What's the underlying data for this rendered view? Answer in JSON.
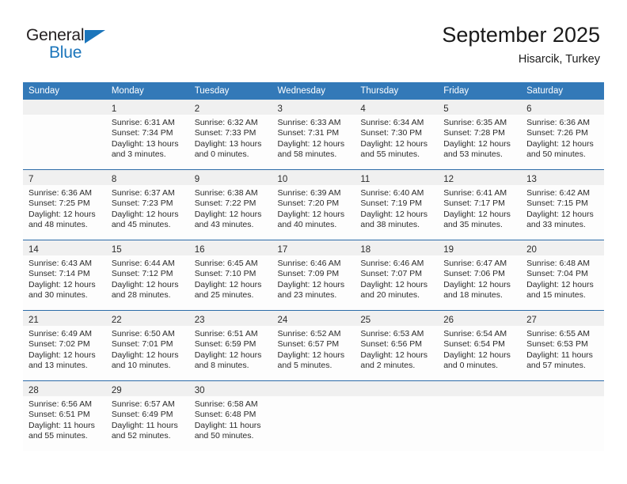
{
  "brand": {
    "name_part1": "General",
    "name_part2": "Blue",
    "triangle_color": "#1b75bb"
  },
  "header": {
    "title": "September 2025",
    "location": "Hisarcik, Turkey"
  },
  "theme": {
    "header_blue": "#3379b8",
    "rule_blue": "#2c6ba8",
    "daynum_band": "#f0f0f0"
  },
  "columns": [
    "Sunday",
    "Monday",
    "Tuesday",
    "Wednesday",
    "Thursday",
    "Friday",
    "Saturday"
  ],
  "weeks": [
    [
      {
        "day": "",
        "sunrise": "",
        "sunset": "",
        "daylight1": "",
        "daylight2": "",
        "empty": true
      },
      {
        "day": "1",
        "sunrise": "Sunrise: 6:31 AM",
        "sunset": "Sunset: 7:34 PM",
        "daylight1": "Daylight: 13 hours",
        "daylight2": "and 3 minutes.",
        "empty": false
      },
      {
        "day": "2",
        "sunrise": "Sunrise: 6:32 AM",
        "sunset": "Sunset: 7:33 PM",
        "daylight1": "Daylight: 13 hours",
        "daylight2": "and 0 minutes.",
        "empty": false
      },
      {
        "day": "3",
        "sunrise": "Sunrise: 6:33 AM",
        "sunset": "Sunset: 7:31 PM",
        "daylight1": "Daylight: 12 hours",
        "daylight2": "and 58 minutes.",
        "empty": false
      },
      {
        "day": "4",
        "sunrise": "Sunrise: 6:34 AM",
        "sunset": "Sunset: 7:30 PM",
        "daylight1": "Daylight: 12 hours",
        "daylight2": "and 55 minutes.",
        "empty": false
      },
      {
        "day": "5",
        "sunrise": "Sunrise: 6:35 AM",
        "sunset": "Sunset: 7:28 PM",
        "daylight1": "Daylight: 12 hours",
        "daylight2": "and 53 minutes.",
        "empty": false
      },
      {
        "day": "6",
        "sunrise": "Sunrise: 6:36 AM",
        "sunset": "Sunset: 7:26 PM",
        "daylight1": "Daylight: 12 hours",
        "daylight2": "and 50 minutes.",
        "empty": false
      }
    ],
    [
      {
        "day": "7",
        "sunrise": "Sunrise: 6:36 AM",
        "sunset": "Sunset: 7:25 PM",
        "daylight1": "Daylight: 12 hours",
        "daylight2": "and 48 minutes.",
        "empty": false
      },
      {
        "day": "8",
        "sunrise": "Sunrise: 6:37 AM",
        "sunset": "Sunset: 7:23 PM",
        "daylight1": "Daylight: 12 hours",
        "daylight2": "and 45 minutes.",
        "empty": false
      },
      {
        "day": "9",
        "sunrise": "Sunrise: 6:38 AM",
        "sunset": "Sunset: 7:22 PM",
        "daylight1": "Daylight: 12 hours",
        "daylight2": "and 43 minutes.",
        "empty": false
      },
      {
        "day": "10",
        "sunrise": "Sunrise: 6:39 AM",
        "sunset": "Sunset: 7:20 PM",
        "daylight1": "Daylight: 12 hours",
        "daylight2": "and 40 minutes.",
        "empty": false
      },
      {
        "day": "11",
        "sunrise": "Sunrise: 6:40 AM",
        "sunset": "Sunset: 7:19 PM",
        "daylight1": "Daylight: 12 hours",
        "daylight2": "and 38 minutes.",
        "empty": false
      },
      {
        "day": "12",
        "sunrise": "Sunrise: 6:41 AM",
        "sunset": "Sunset: 7:17 PM",
        "daylight1": "Daylight: 12 hours",
        "daylight2": "and 35 minutes.",
        "empty": false
      },
      {
        "day": "13",
        "sunrise": "Sunrise: 6:42 AM",
        "sunset": "Sunset: 7:15 PM",
        "daylight1": "Daylight: 12 hours",
        "daylight2": "and 33 minutes.",
        "empty": false
      }
    ],
    [
      {
        "day": "14",
        "sunrise": "Sunrise: 6:43 AM",
        "sunset": "Sunset: 7:14 PM",
        "daylight1": "Daylight: 12 hours",
        "daylight2": "and 30 minutes.",
        "empty": false
      },
      {
        "day": "15",
        "sunrise": "Sunrise: 6:44 AM",
        "sunset": "Sunset: 7:12 PM",
        "daylight1": "Daylight: 12 hours",
        "daylight2": "and 28 minutes.",
        "empty": false
      },
      {
        "day": "16",
        "sunrise": "Sunrise: 6:45 AM",
        "sunset": "Sunset: 7:10 PM",
        "daylight1": "Daylight: 12 hours",
        "daylight2": "and 25 minutes.",
        "empty": false
      },
      {
        "day": "17",
        "sunrise": "Sunrise: 6:46 AM",
        "sunset": "Sunset: 7:09 PM",
        "daylight1": "Daylight: 12 hours",
        "daylight2": "and 23 minutes.",
        "empty": false
      },
      {
        "day": "18",
        "sunrise": "Sunrise: 6:46 AM",
        "sunset": "Sunset: 7:07 PM",
        "daylight1": "Daylight: 12 hours",
        "daylight2": "and 20 minutes.",
        "empty": false
      },
      {
        "day": "19",
        "sunrise": "Sunrise: 6:47 AM",
        "sunset": "Sunset: 7:06 PM",
        "daylight1": "Daylight: 12 hours",
        "daylight2": "and 18 minutes.",
        "empty": false
      },
      {
        "day": "20",
        "sunrise": "Sunrise: 6:48 AM",
        "sunset": "Sunset: 7:04 PM",
        "daylight1": "Daylight: 12 hours",
        "daylight2": "and 15 minutes.",
        "empty": false
      }
    ],
    [
      {
        "day": "21",
        "sunrise": "Sunrise: 6:49 AM",
        "sunset": "Sunset: 7:02 PM",
        "daylight1": "Daylight: 12 hours",
        "daylight2": "and 13 minutes.",
        "empty": false
      },
      {
        "day": "22",
        "sunrise": "Sunrise: 6:50 AM",
        "sunset": "Sunset: 7:01 PM",
        "daylight1": "Daylight: 12 hours",
        "daylight2": "and 10 minutes.",
        "empty": false
      },
      {
        "day": "23",
        "sunrise": "Sunrise: 6:51 AM",
        "sunset": "Sunset: 6:59 PM",
        "daylight1": "Daylight: 12 hours",
        "daylight2": "and 8 minutes.",
        "empty": false
      },
      {
        "day": "24",
        "sunrise": "Sunrise: 6:52 AM",
        "sunset": "Sunset: 6:57 PM",
        "daylight1": "Daylight: 12 hours",
        "daylight2": "and 5 minutes.",
        "empty": false
      },
      {
        "day": "25",
        "sunrise": "Sunrise: 6:53 AM",
        "sunset": "Sunset: 6:56 PM",
        "daylight1": "Daylight: 12 hours",
        "daylight2": "and 2 minutes.",
        "empty": false
      },
      {
        "day": "26",
        "sunrise": "Sunrise: 6:54 AM",
        "sunset": "Sunset: 6:54 PM",
        "daylight1": "Daylight: 12 hours",
        "daylight2": "and 0 minutes.",
        "empty": false
      },
      {
        "day": "27",
        "sunrise": "Sunrise: 6:55 AM",
        "sunset": "Sunset: 6:53 PM",
        "daylight1": "Daylight: 11 hours",
        "daylight2": "and 57 minutes.",
        "empty": false
      }
    ],
    [
      {
        "day": "28",
        "sunrise": "Sunrise: 6:56 AM",
        "sunset": "Sunset: 6:51 PM",
        "daylight1": "Daylight: 11 hours",
        "daylight2": "and 55 minutes.",
        "empty": false
      },
      {
        "day": "29",
        "sunrise": "Sunrise: 6:57 AM",
        "sunset": "Sunset: 6:49 PM",
        "daylight1": "Daylight: 11 hours",
        "daylight2": "and 52 minutes.",
        "empty": false
      },
      {
        "day": "30",
        "sunrise": "Sunrise: 6:58 AM",
        "sunset": "Sunset: 6:48 PM",
        "daylight1": "Daylight: 11 hours",
        "daylight2": "and 50 minutes.",
        "empty": false
      },
      {
        "day": "",
        "sunrise": "",
        "sunset": "",
        "daylight1": "",
        "daylight2": "",
        "empty": true
      },
      {
        "day": "",
        "sunrise": "",
        "sunset": "",
        "daylight1": "",
        "daylight2": "",
        "empty": true
      },
      {
        "day": "",
        "sunrise": "",
        "sunset": "",
        "daylight1": "",
        "daylight2": "",
        "empty": true
      },
      {
        "day": "",
        "sunrise": "",
        "sunset": "",
        "daylight1": "",
        "daylight2": "",
        "empty": true
      }
    ]
  ]
}
